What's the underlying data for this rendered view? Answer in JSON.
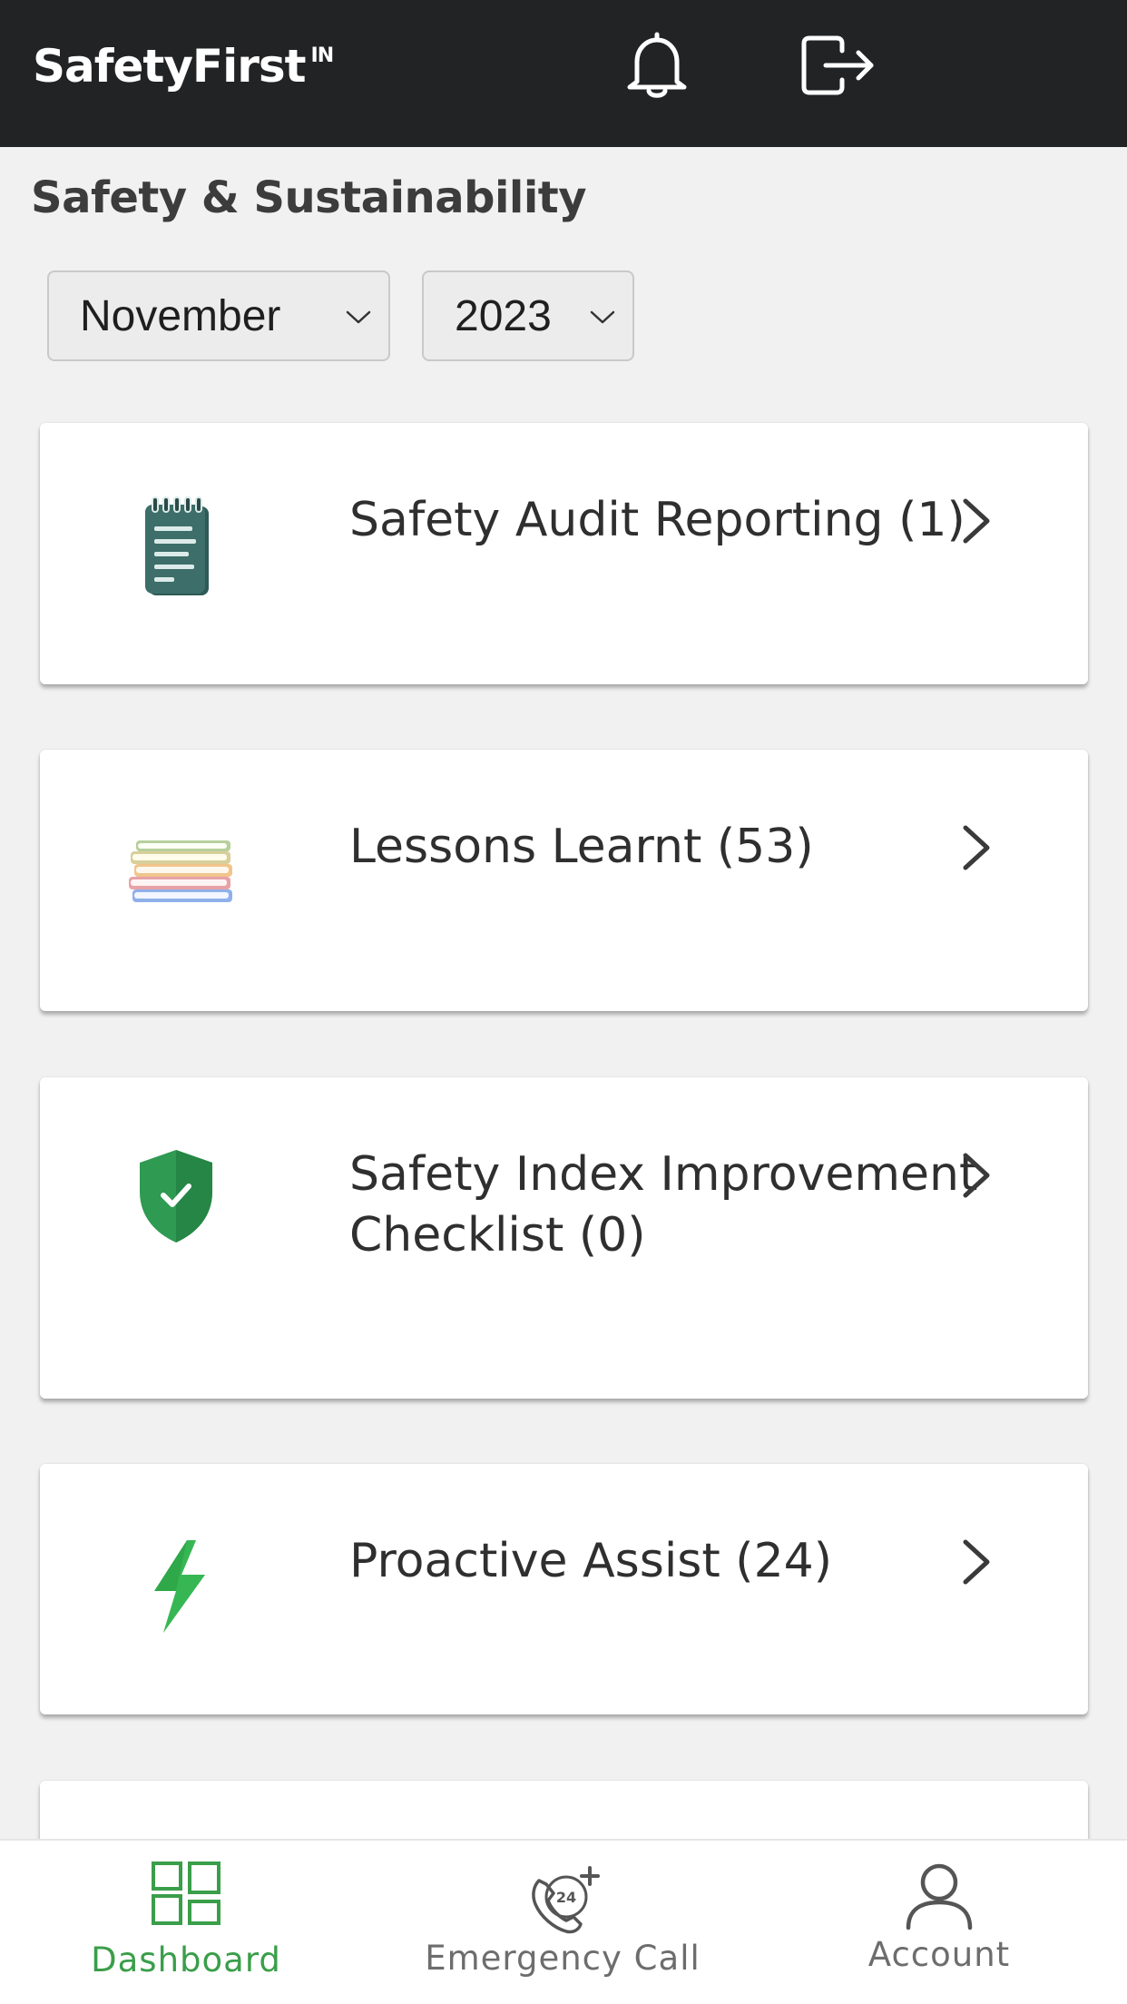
{
  "header": {
    "brand": "SafetyFirst",
    "brand_sup": "IN",
    "icons": [
      "bell-icon",
      "logout-icon"
    ]
  },
  "section": {
    "title": "Safety & Sustainability"
  },
  "filters": {
    "month": "November",
    "year": "2023"
  },
  "cards": [
    {
      "label": "Safety Audit Reporting (1)",
      "icon": "notepad-icon"
    },
    {
      "label": "Lessons Learnt (53)",
      "icon": "books-icon"
    },
    {
      "label": "Safety Index Improvement Checklist (0)",
      "icon": "shield-check-icon"
    },
    {
      "label": "Proactive Assist (24)",
      "icon": "lightning-icon"
    }
  ],
  "bottom_nav": {
    "dashboard": "Dashboard",
    "emergency": "Emergency Call",
    "account": "Account",
    "active": "Dashboard"
  },
  "colors": {
    "topbar": "#222325",
    "accent_green": "#3a9e4a",
    "background": "#f1f1f1"
  }
}
